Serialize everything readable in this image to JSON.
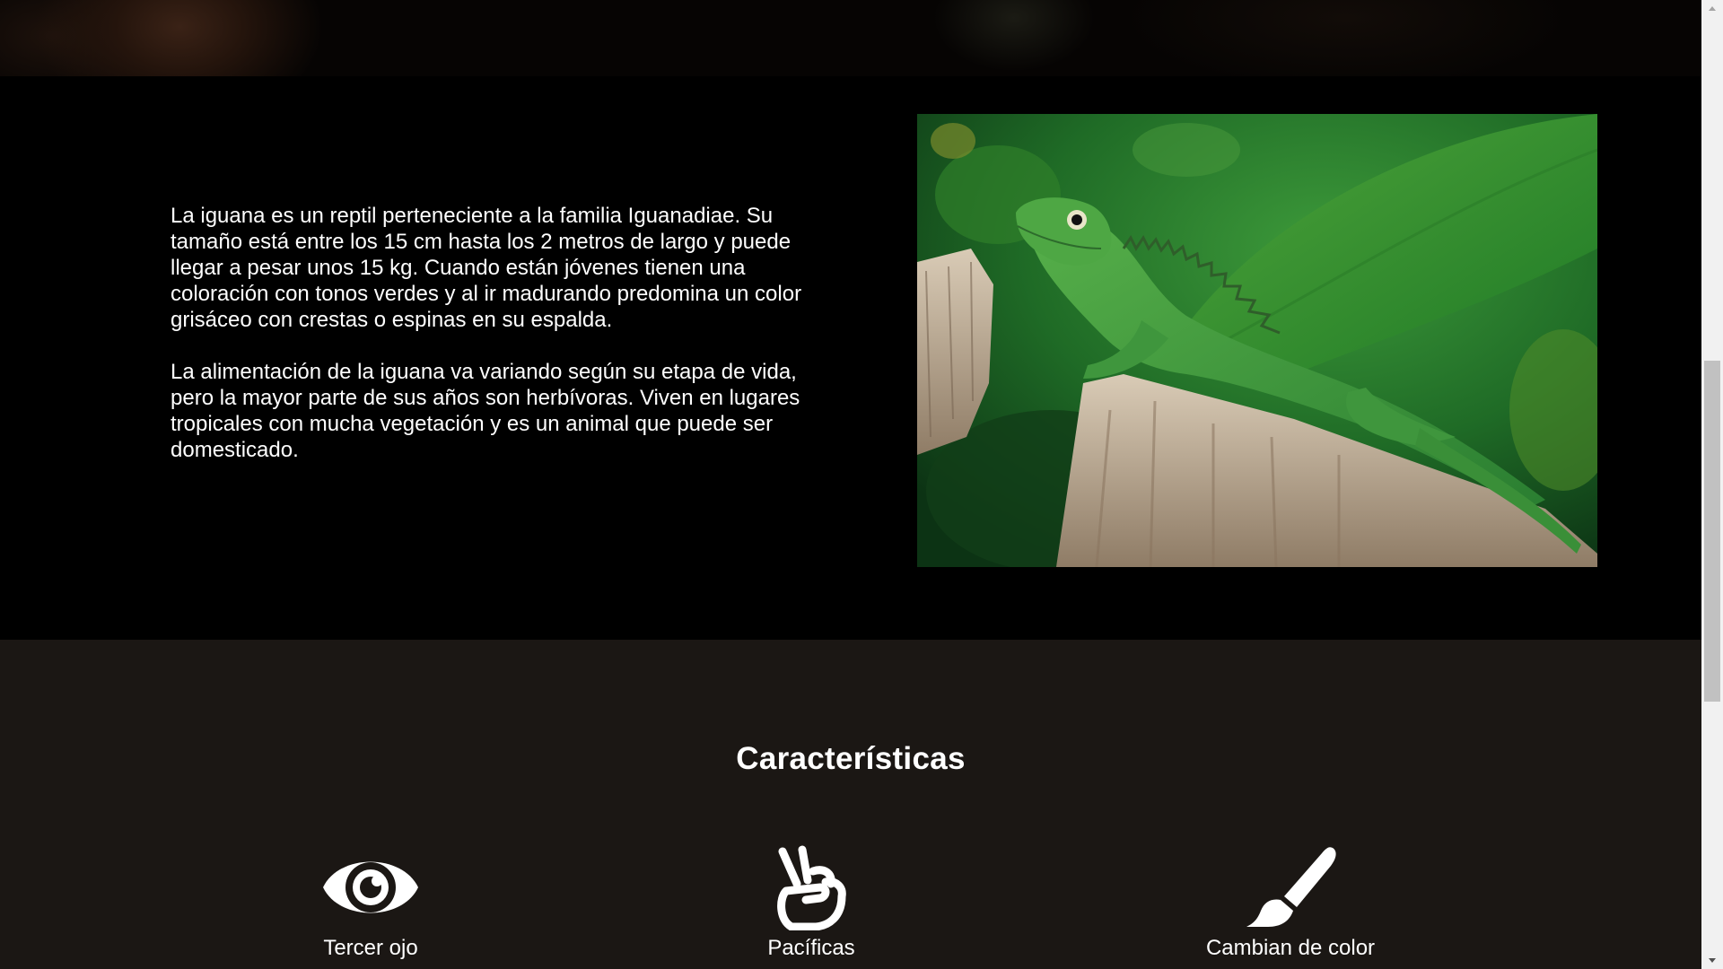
{
  "intro": {
    "paragraphs": [
      "La iguana es un reptil perteneciente a la familia Iguanadiae. Su tamaño está entre los 15 cm hasta los 2 metros de largo y puede llegar a pesar unos 15 kg. Cuando están jóvenes tienen una coloración con tonos verdes y al ir madurando predomina un color grisáceo con crestas o espinas en su espalda.",
      "La alimentación de la iguana va variando según su etapa de vida, pero la mayor parte de sus años son herbívoras. Viven en lugares tropicales con mucha vegetación y es un animal que puede ser domesticado."
    ]
  },
  "features": {
    "title": "Características",
    "items": [
      {
        "icon": "eye-icon",
        "label": "Tercer ojo"
      },
      {
        "icon": "peace-hand-icon",
        "label": "Pacíficas"
      },
      {
        "icon": "paintbrush-icon",
        "label": "Cambian de color"
      }
    ]
  },
  "colors": {
    "intro_bg": "#000000",
    "features_bg": "#1b1714",
    "text": "#ffffff",
    "iguana_green": "#3f9a3c"
  }
}
